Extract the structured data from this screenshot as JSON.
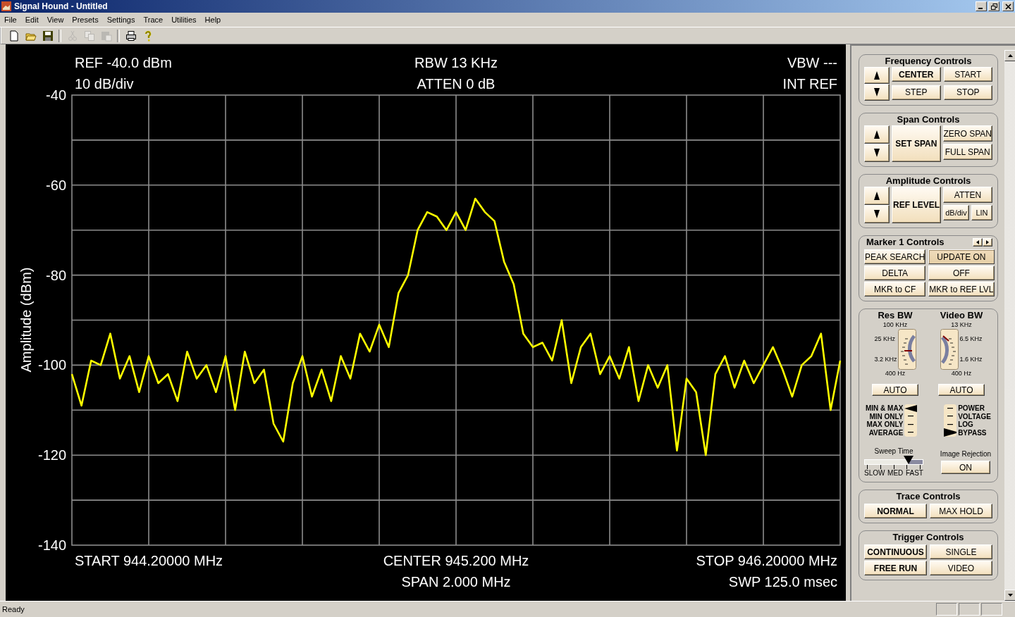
{
  "window": {
    "title": "Signal Hound - Untitled"
  },
  "menu": [
    "File",
    "Edit",
    "View",
    "Presets",
    "Settings",
    "Trace",
    "Utilities",
    "Help"
  ],
  "toolbar": [
    {
      "disabled": false
    },
    {
      "disabled": false
    },
    {
      "disabled": false
    },
    {
      "disabled": true
    },
    {
      "disabled": true
    },
    {
      "disabled": true
    },
    {
      "disabled": false
    },
    {
      "disabled": false
    }
  ],
  "display": {
    "header_left": [
      "REF -40.0 dBm",
      "10 dB/div"
    ],
    "header_center": [
      "RBW 13 KHz",
      "ATTEN 0 dB"
    ],
    "header_right": [
      "VBW ---",
      "INT REF"
    ],
    "footer_left": [
      "START 944.20000 MHz"
    ],
    "footer_center": [
      "CENTER 945.200 MHz",
      "SPAN 2.000 MHz"
    ],
    "footer_right": [
      "STOP 946.20000 MHz",
      "SWP 125.0 msec"
    ],
    "chart_data": {
      "type": "line",
      "ylabel": "Amplitude (dBm)",
      "grid": true,
      "ylim": [
        -140,
        -40
      ],
      "yticks": [
        -40,
        -60,
        -80,
        -100,
        -120,
        -140
      ],
      "series": [
        {
          "color": "#ffff00",
          "values": [
            -102,
            -109,
            -99,
            -100,
            -93,
            -103,
            -98,
            -106,
            -98,
            -104,
            -102,
            -108,
            -97,
            -103,
            -100,
            -106,
            -98,
            -110,
            -97,
            -104,
            -101,
            -113,
            -117,
            -104,
            -98,
            -107,
            -101,
            -108,
            -98,
            -103,
            -93,
            -97,
            -91,
            -96,
            -84,
            -80,
            -70,
            -66,
            -67,
            -70,
            -66,
            -70,
            -63,
            -66,
            -68,
            -77,
            -82,
            -93,
            -96,
            -95,
            -99,
            -90,
            -104,
            -96,
            -93,
            -102,
            -98,
            -103,
            -96,
            -108,
            -100,
            -105,
            -100,
            -119,
            -103,
            -106,
            -120,
            -102,
            -98,
            -105,
            -99,
            -104,
            -100,
            -96,
            -101,
            -107,
            -100,
            -98,
            -93,
            -110,
            -99
          ]
        }
      ]
    }
  },
  "frequency_controls": {
    "title": "Frequency Controls",
    "buttons": [
      {
        "label": "CENTER",
        "selected": true
      },
      {
        "label": "START",
        "selected": false
      },
      {
        "label": "STEP",
        "selected": false
      },
      {
        "label": "STOP",
        "selected": false
      }
    ]
  },
  "span_controls": {
    "title": "Span Controls",
    "buttons": [
      {
        "label": "SET SPAN",
        "selected": true
      },
      {
        "label": "ZERO SPAN",
        "selected": false
      },
      {
        "label": "FULL SPAN",
        "selected": false
      }
    ]
  },
  "amplitude_controls": {
    "title": "Amplitude Controls",
    "buttons": [
      {
        "label": "REF LEVEL",
        "selected": true
      },
      {
        "label": "ATTEN",
        "selected": false
      },
      {
        "label": "dB/div",
        "selected": false
      },
      {
        "label": "LIN",
        "selected": false
      }
    ]
  },
  "marker_controls": {
    "title": "Marker 1 Controls",
    "buttons": [
      {
        "label": "PEAK SEARCH",
        "pressed": false
      },
      {
        "label": "UPDATE ON",
        "pressed": true
      },
      {
        "label": "DELTA",
        "pressed": false
      },
      {
        "label": "OFF",
        "pressed": false
      },
      {
        "label": "MKR to CF",
        "pressed": false
      },
      {
        "label": "MKR to REF LVL",
        "pressed": false
      }
    ]
  },
  "res_bw": {
    "title": "Res BW",
    "scale": [
      "100 KHz",
      "25 KHz",
      "3.2 KHz",
      "400 Hz"
    ],
    "button": "AUTO"
  },
  "video_bw": {
    "title": "Video BW",
    "scale": [
      "13 KHz",
      "6.5 KHz",
      "1.6 KHz",
      "400 Hz"
    ],
    "button": "AUTO"
  },
  "detector": {
    "options": [
      {
        "label": "MIN & MAX",
        "selected": true
      },
      {
        "label": "MIN ONLY",
        "selected": false
      },
      {
        "label": "MAX ONLY",
        "selected": false
      },
      {
        "label": "AVERAGE",
        "selected": false
      }
    ]
  },
  "video_mode": {
    "options": [
      {
        "label": "POWER",
        "selected": false
      },
      {
        "label": "VOLTAGE",
        "selected": false
      },
      {
        "label": "LOG",
        "selected": false
      },
      {
        "label": "BYPASS",
        "selected": true
      }
    ]
  },
  "sweep_time": {
    "title": "Sweep Time",
    "level": 0.75,
    "labels": [
      "SLOW",
      "MED",
      "FAST"
    ]
  },
  "image_rejection": {
    "title": "Image Rejection",
    "button": "ON"
  },
  "trace_controls": {
    "title": "Trace Controls",
    "buttons": [
      {
        "label": "NORMAL",
        "selected": true
      },
      {
        "label": "MAX HOLD",
        "selected": false
      }
    ]
  },
  "trigger_controls": {
    "title": "Trigger Controls",
    "buttons": [
      {
        "label": "CONTINUOUS",
        "selected": true
      },
      {
        "label": "SINGLE",
        "selected": false
      },
      {
        "label": "FREE RUN",
        "selected": true
      },
      {
        "label": "VIDEO",
        "selected": false
      }
    ]
  },
  "status_bar": {
    "text": "Ready"
  }
}
